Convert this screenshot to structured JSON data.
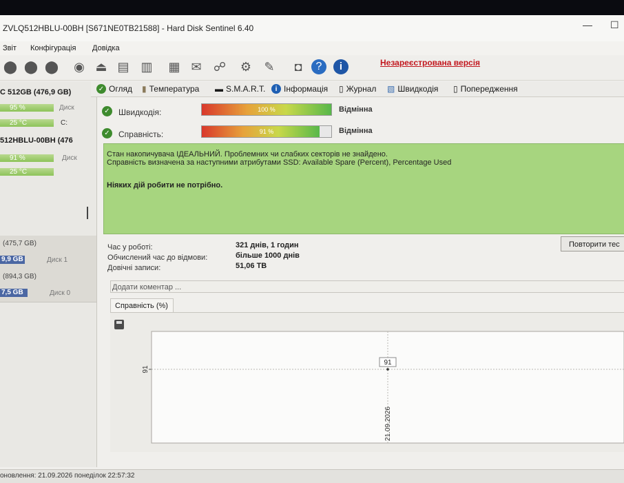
{
  "window": {
    "title": "ZVLQ512HBLU-00BH [S671NE0TB21588]  -  Hard Disk Sentinel 6.40",
    "unregistered": "Незареєстрована версія"
  },
  "menu": [
    "Звіт",
    "Конфігурація",
    "Довідка"
  ],
  "left_panel": {
    "drives": [
      {
        "name": "C 512GB (476,9 GB)",
        "health_pct": "95 %",
        "health": 0.95,
        "health_lbl": "Диск",
        "temp": "25 °C",
        "temp_lbl": "C:"
      },
      {
        "name": "512HBLU-00BH (476",
        "health_pct": "91 %",
        "health": 0.91,
        "health_lbl": "Диск",
        "temp": "25 °C"
      }
    ],
    "volumes": [
      {
        "size": "(475,7 GB)",
        "used": "9,9 GB",
        "disk": "Диск 1"
      },
      {
        "size": "(894,3 GB)",
        "used": "7,5 GB",
        "disk": "Диск 0"
      }
    ]
  },
  "tabs": [
    "Огляд",
    "Температура",
    "S.M.A.R.T.",
    "Інформація",
    "Журнал",
    "Швидкодія",
    "Попередження"
  ],
  "status": {
    "speed_label": "Швидкодія:",
    "speed_value": "100 %",
    "speed_fraction": 1.0,
    "speed_verdict": "Відмінна",
    "health_label": "Справність:",
    "health_value": "91 %",
    "health_fraction": 0.91,
    "health_verdict": "Відмінна"
  },
  "message": {
    "line1": "Стан накопичувача ІДЕАЛЬНИЙ. Проблемних чи слабких секторів не знайдено.",
    "line2": "Справність визначена за наступними атрибутами SSD:  Available Spare (Percent), Percentage Used",
    "line3": "Ніяких дій робити не потрібно."
  },
  "info": {
    "uptime_label": "Час у роботі:",
    "uptime_value": "321 днів, 1 годин",
    "ttf_label": "Обчислений час до відмови:",
    "ttf_value": "більше 1000 днів",
    "writes_label": "Довічні записи:",
    "writes_value": "51,06 TB",
    "repeat_button": "Повторити тес"
  },
  "comment_placeholder": "Додати коментар ...",
  "chart_tab": "Справність (%)",
  "chart_data": {
    "type": "line",
    "x": [
      "21.09.2026"
    ],
    "series": [
      {
        "values": [
          91
        ]
      }
    ],
    "ytick": "91",
    "xtick": "21.09.2026",
    "point_label": "91",
    "grid": true
  },
  "footer": {
    "text": "оновлення: 21.09.2026 понеділок 22:57:32"
  }
}
